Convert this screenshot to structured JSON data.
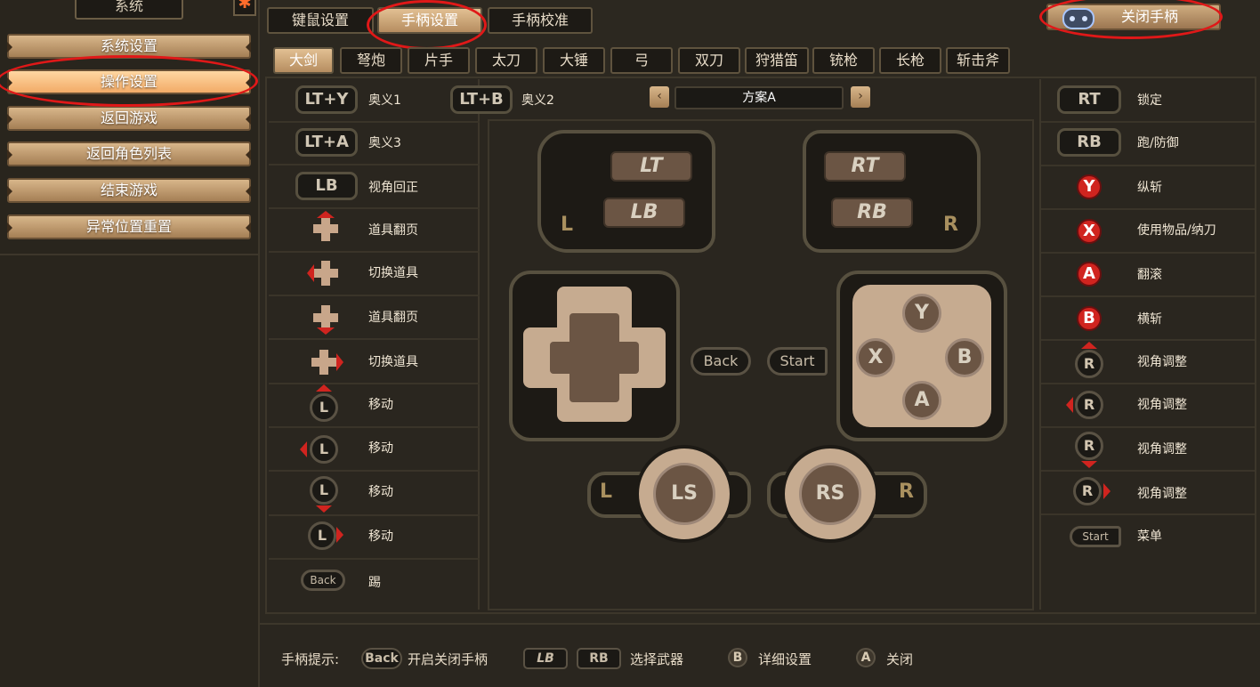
{
  "sidebar": {
    "title": "系统",
    "close_icon": "gear-close-icon",
    "items": [
      "系统设置",
      "操作设置",
      "返回游戏",
      "返回角色列表",
      "结束游戏",
      "异常位置重置"
    ],
    "active_index": 1
  },
  "top_tabs": [
    "键鼠设置",
    "手柄设置",
    "手柄校准"
  ],
  "top_active": 1,
  "close_pad": {
    "label": "关闭手柄",
    "icon": "gamepad-icon"
  },
  "weapons": [
    "大剑",
    "弩炮",
    "片手",
    "太刀",
    "大锤",
    "弓",
    "双刀",
    "狩猎笛",
    "铳枪",
    "长枪",
    "斩击斧"
  ],
  "weapon_active": 0,
  "scheme": {
    "label": "方案A",
    "prev": "‹",
    "next": "›"
  },
  "left_bindings": [
    {
      "key": "LT+Y",
      "label": "奥义1"
    },
    {
      "key": "LT+B",
      "label": "奥义2"
    },
    {
      "key": "LT+A",
      "label": "奥义3"
    },
    {
      "key": "LB",
      "label": "视角回正"
    },
    {
      "key": "dpad-up",
      "label": "道具翻页"
    },
    {
      "key": "dpad-left",
      "label": "切换道具"
    },
    {
      "key": "dpad-down",
      "label": "道具翻页"
    },
    {
      "key": "dpad-right",
      "label": "切换道具"
    },
    {
      "key": "L-up",
      "label": "移动"
    },
    {
      "key": "L-left",
      "label": "移动"
    },
    {
      "key": "L-down",
      "label": "移动"
    },
    {
      "key": "L-right",
      "label": "移动"
    },
    {
      "key": "Back",
      "label": "踢"
    }
  ],
  "right_bindings": [
    {
      "key": "RT",
      "label": "锁定"
    },
    {
      "key": "RB",
      "label": "跑/防御"
    },
    {
      "key": "Y",
      "label": "纵斩"
    },
    {
      "key": "X",
      "label": "使用物品/纳刀"
    },
    {
      "key": "A",
      "label": "翻滚"
    },
    {
      "key": "B",
      "label": "横斩"
    },
    {
      "key": "R-up",
      "label": "视角调整"
    },
    {
      "key": "R-left",
      "label": "视角调整"
    },
    {
      "key": "R-down",
      "label": "视角调整"
    },
    {
      "key": "R-right",
      "label": "视角调整"
    },
    {
      "key": "Start",
      "label": "菜单"
    }
  ],
  "controller": {
    "lt": "LT",
    "lb": "LB",
    "rt": "RT",
    "rb": "RB",
    "l": "L",
    "r": "R",
    "back": "Back",
    "start": "Start",
    "y": "Y",
    "x": "X",
    "b": "B",
    "a": "A",
    "ls": "LS",
    "rs": "RS"
  },
  "hints": {
    "label": "手柄提示:",
    "back_key": "Back",
    "back_text": "开启关闭手柄",
    "lb": "LB",
    "rb": "RB",
    "weapon_text": "选择武器",
    "b": "B",
    "b_text": "详细设置",
    "a": "A",
    "a_text": "关闭"
  },
  "colors": {
    "accent": "#f2ab67",
    "highlight_ring": "#e01818",
    "red_button": "#d0241f"
  }
}
